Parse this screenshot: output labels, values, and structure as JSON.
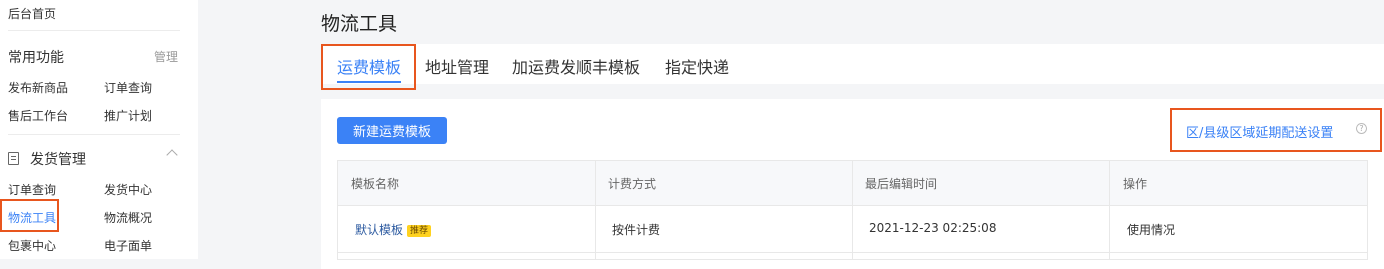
{
  "sidebar": {
    "home": "后台首页",
    "common": {
      "title": "常用功能",
      "manage": "管理",
      "items": [
        "发布新商品",
        "订单查询",
        "售后工作台",
        "推广计划"
      ]
    },
    "shipping": {
      "title": "发货管理",
      "items": [
        "订单查询",
        "发货中心",
        "物流工具",
        "物流概况",
        "包裹中心",
        "电子面单"
      ],
      "active": "物流工具"
    }
  },
  "main": {
    "title": "物流工具",
    "tabs": [
      "运费模板",
      "地址管理",
      "加运费发顺丰模板",
      "指定快递"
    ],
    "active_tab": "运费模板",
    "new_button": "新建运费模板",
    "delay_setting_link": "区/县级区域延期配送设置",
    "help_icon_glyph": "?",
    "table": {
      "headers": [
        "模板名称",
        "计费方式",
        "最后编辑时间",
        "操作"
      ],
      "rows": [
        {
          "name": "默认模板",
          "badge": "推荐",
          "billing": "按件计费",
          "edited": "2021-12-23 02:25:08",
          "action": "使用情况"
        }
      ]
    }
  },
  "colors": {
    "accent": "#3b82f6",
    "highlight_box": "#e8561e",
    "badge": "#ffd21f"
  }
}
